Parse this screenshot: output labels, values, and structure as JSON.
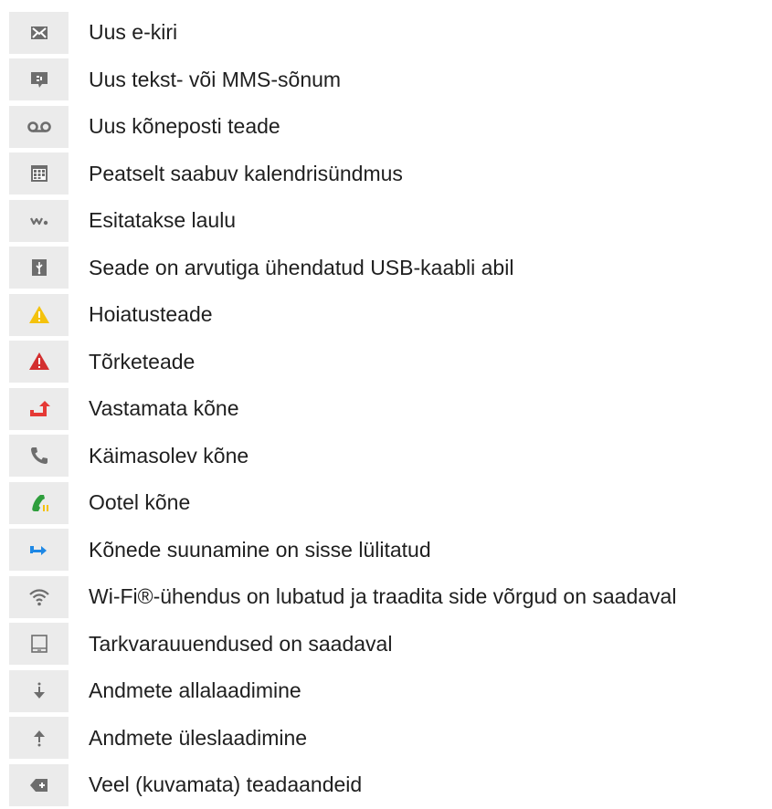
{
  "items": [
    {
      "icon": "email-icon",
      "label": "Uus e-kiri"
    },
    {
      "icon": "text-message-icon",
      "label": "Uus tekst- või MMS-sõnum"
    },
    {
      "icon": "voicemail-icon",
      "label": "Uus kõneposti teade"
    },
    {
      "icon": "calendar-icon",
      "label": "Peatselt saabuv kalendrisündmus"
    },
    {
      "icon": "walkman-icon",
      "label": "Esitatakse laulu"
    },
    {
      "icon": "usb-icon",
      "label": "Seade on arvutiga ühendatud USB-kaabli abil"
    },
    {
      "icon": "warning-icon",
      "label": "Hoiatusteade"
    },
    {
      "icon": "error-icon",
      "label": "Tõrketeade"
    },
    {
      "icon": "missed-call-icon",
      "label": "Vastamata kõne"
    },
    {
      "icon": "call-icon",
      "label": "Käimasolev kõne"
    },
    {
      "icon": "call-on-hold-icon",
      "label": "Ootel kõne"
    },
    {
      "icon": "call-forward-icon",
      "label": "Kõnede suunamine on sisse lülitatud"
    },
    {
      "icon": "wifi-icon",
      "label": "Wi-Fi®-ühendus on lubatud ja traadita side võrgud on saadaval"
    },
    {
      "icon": "software-update-icon",
      "label": "Tarkvarauuendused on saadaval"
    },
    {
      "icon": "download-icon",
      "label": "Andmete allalaadimine"
    },
    {
      "icon": "upload-icon",
      "label": "Andmete üleslaadimine"
    },
    {
      "icon": "more-notifications-icon",
      "label": "Veel (kuvamata) teadaandeid"
    }
  ],
  "colors": {
    "icon_grey": "#6d6d6d",
    "warning_yellow": "#f4c20d",
    "error_red": "#d32f2f",
    "missed_red": "#e53935",
    "call_green": "#2e9e3c",
    "forward_blue": "#1e88e5",
    "icon_background": "#ebebeb"
  }
}
